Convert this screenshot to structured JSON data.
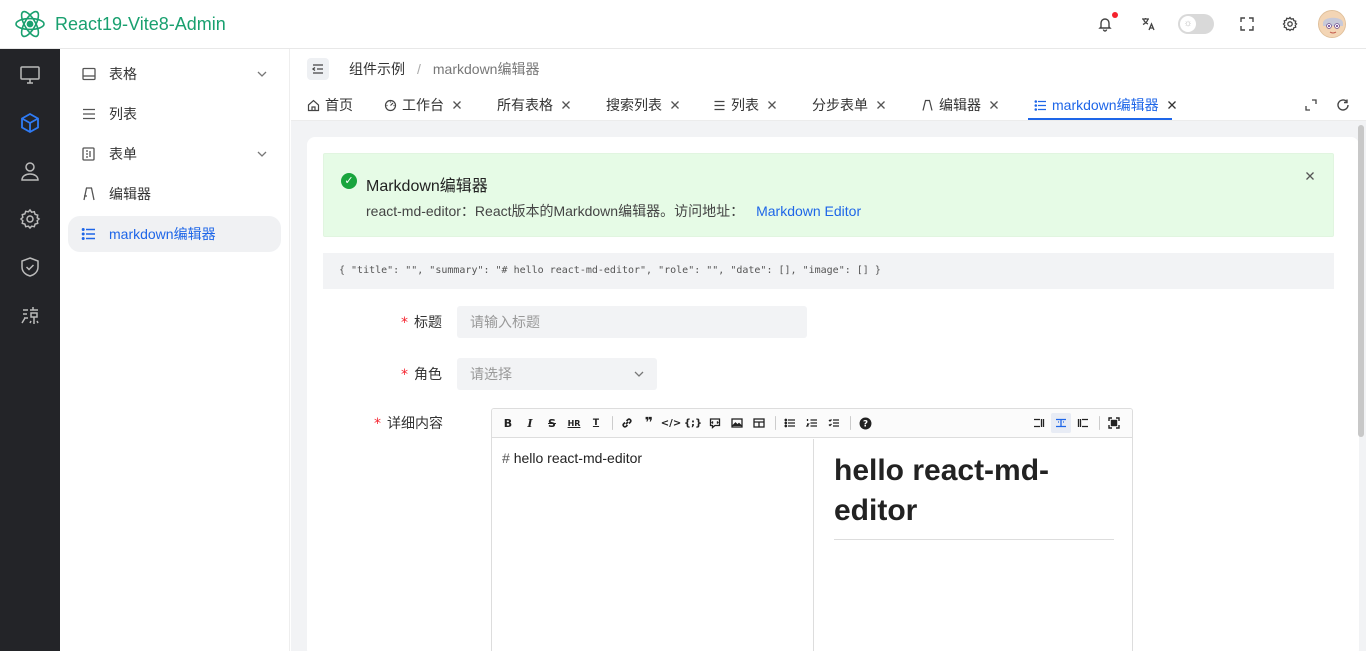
{
  "header": {
    "app_title": "React19-Vite8-Admin"
  },
  "rail": {
    "items": [
      "monitor-icon",
      "cube-icon",
      "user-icon",
      "gear-icon",
      "shield-icon",
      "bug-icon"
    ]
  },
  "submenu": {
    "items": [
      {
        "label": "表格",
        "icon": "table-icon",
        "expandable": true
      },
      {
        "label": "列表",
        "icon": "list-icon",
        "expandable": false
      },
      {
        "label": "表单",
        "icon": "form-icon",
        "expandable": true
      },
      {
        "label": "编辑器",
        "icon": "editor-icon",
        "expandable": false
      },
      {
        "label": "markdown编辑器",
        "icon": "list-icon",
        "expandable": false,
        "active": true
      }
    ]
  },
  "breadcrumb": {
    "parent": "组件示例",
    "separator": "/",
    "current": "markdown编辑器"
  },
  "tabs": [
    {
      "label": "首页",
      "closable": false
    },
    {
      "label": "工作台",
      "closable": true
    },
    {
      "label": "所有表格",
      "closable": true
    },
    {
      "label": "搜索列表",
      "closable": true
    },
    {
      "label": "列表",
      "closable": true
    },
    {
      "label": "分步表单",
      "closable": true
    },
    {
      "label": "编辑器",
      "closable": true
    },
    {
      "label": "markdown编辑器",
      "closable": true,
      "active": true
    }
  ],
  "alert": {
    "title": "Markdown编辑器",
    "description": "react-md-editor：React版本的Markdown编辑器。访问地址：",
    "link_text": "Markdown Editor"
  },
  "json_preview": "{ \"title\": \"\", \"summary\": \"# hello react-md-editor\", \"role\": \"\", \"date\": [], \"image\": [] }",
  "form": {
    "title_label": "标题",
    "title_placeholder": "请输入标题",
    "role_label": "角色",
    "role_placeholder": "请选择",
    "content_label": "详细内容",
    "required_mark": "*"
  },
  "editor": {
    "source_hash": "#",
    "source_text": "hello react-md-editor",
    "preview_heading": "hello react-md-editor",
    "toolbar": [
      "B",
      "I",
      "S",
      "HR",
      "T",
      "link",
      "quote",
      "code",
      "codeblock",
      "comment",
      "image",
      "table",
      "ul",
      "ol",
      "checklist",
      "help"
    ]
  },
  "colors": {
    "brand": "#19a06f",
    "primary": "#1e66e8",
    "alert_bg": "#e6fbe6",
    "sidebar_bg": "#232428",
    "required": "#f5222d"
  }
}
